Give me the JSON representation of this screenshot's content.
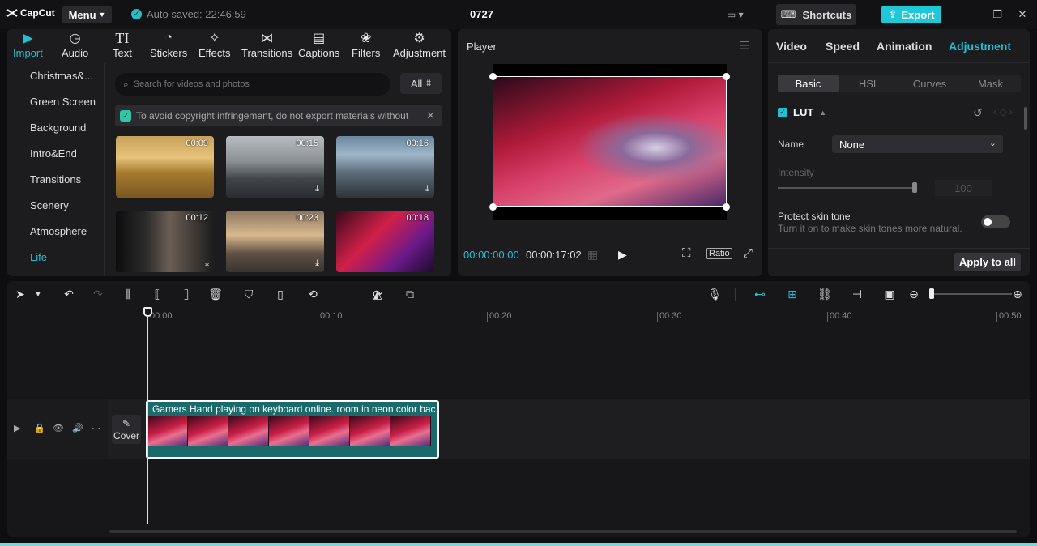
{
  "app": {
    "logo_text": "CapCut",
    "menu_label": "Menu",
    "autosave_text": "Auto saved: 22:46:59",
    "project_title": "0727",
    "shortcuts_label": "Shortcuts",
    "export_label": "Export",
    "accent_color": "#22c0d4"
  },
  "media": {
    "tool_tabs": [
      {
        "label": "Import",
        "icon": "import-icon"
      },
      {
        "label": "Audio",
        "icon": "audio-icon"
      },
      {
        "label": "Text",
        "icon": "text-icon"
      },
      {
        "label": "Stickers",
        "icon": "stickers-icon"
      },
      {
        "label": "Effects",
        "icon": "effects-icon"
      },
      {
        "label": "Transitions",
        "icon": "transitions-icon"
      },
      {
        "label": "Captions",
        "icon": "captions-icon"
      },
      {
        "label": "Filters",
        "icon": "filters-icon"
      },
      {
        "label": "Adjustment",
        "icon": "adjustment-icon"
      }
    ],
    "categories": [
      "Christmas&...",
      "Green Screen",
      "Background",
      "Intro&End",
      "Transitions",
      "Scenery",
      "Atmosphere",
      "Life"
    ],
    "active_category": "Life",
    "search_placeholder": "Search for videos and photos",
    "filter_label": "All",
    "notice_text": "To avoid copyright infringement, do not export materials without",
    "thumbnails": [
      {
        "duration": "00:09",
        "downloadable": false
      },
      {
        "duration": "00:15",
        "downloadable": true
      },
      {
        "duration": "00:16",
        "downloadable": true
      },
      {
        "duration": "00:12",
        "downloadable": true
      },
      {
        "duration": "00:23",
        "downloadable": true
      },
      {
        "duration": "00:18",
        "downloadable": false
      }
    ]
  },
  "player": {
    "title": "Player",
    "current_time": "00:00:00:00",
    "total_time": "00:00:17:02",
    "ratio_label": "Ratio"
  },
  "props": {
    "tabs": [
      "Video",
      "Speed",
      "Animation",
      "Adjustment"
    ],
    "active_tab": "Adjustment",
    "subtabs": [
      "Basic",
      "HSL",
      "Curves",
      "Mask"
    ],
    "active_subtab": "Basic",
    "lut_label": "LUT",
    "name_label": "Name",
    "name_value": "None",
    "intensity_label": "Intensity",
    "intensity_value": "100",
    "skin_label": "Protect skin tone",
    "skin_desc": "Turn it on to make skin tones more natural.",
    "apply_label": "Apply to all"
  },
  "timeline": {
    "ruler": [
      "00:00",
      "00:10",
      "00:20",
      "00:30",
      "00:40",
      "00:50"
    ],
    "clip_title": "Gamers Hand playing on keyboard online. room  in neon color bac",
    "cover_label": "Cover"
  }
}
